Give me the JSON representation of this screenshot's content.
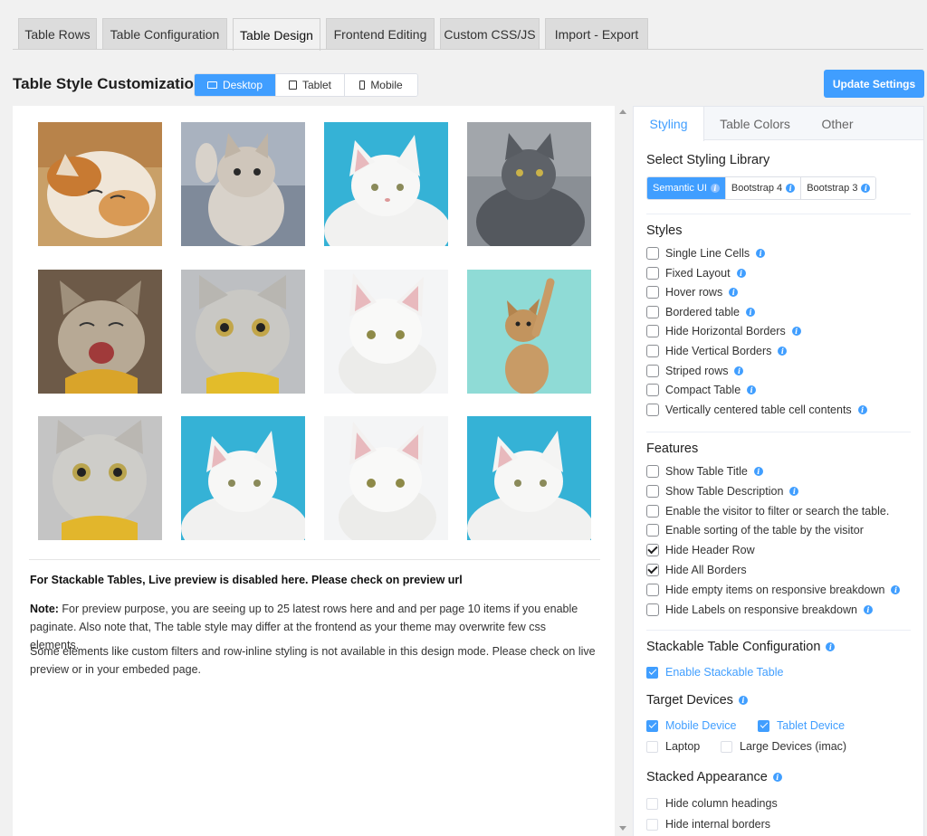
{
  "top_tabs": [
    {
      "label": "Table Rows",
      "active": false
    },
    {
      "label": "Table Configuration",
      "active": false
    },
    {
      "label": "Table Design",
      "active": true
    },
    {
      "label": "Frontend Editing",
      "active": false
    },
    {
      "label": "Custom CSS/JS",
      "active": false
    },
    {
      "label": "Import - Export",
      "active": false
    }
  ],
  "header": {
    "title": "Table Style Customization",
    "devices": [
      {
        "label": "Desktop",
        "icon": "desktop-icon",
        "active": true
      },
      {
        "label": "Tablet",
        "icon": "tablet-icon",
        "active": false
      },
      {
        "label": "Mobile",
        "icon": "mobile-icon",
        "active": false
      }
    ],
    "update_button": "Update Settings"
  },
  "preview": {
    "images": [
      "cat-photo-calico-sleeping",
      "cat-photo-tabby-kitten-waving",
      "cat-photo-white-blue-background",
      "cat-photo-grey-russian-blue",
      "cat-photo-tabby-kitten-yawning",
      "cat-photo-grey-kitten-yellow-scarf",
      "cat-photo-white-kitten",
      "cat-photo-ginger-kitten-reaching",
      "cat-photo-grey-kitten-yellow-scarf-2",
      "cat-photo-white-blue-background-2",
      "cat-photo-white-kitten-2",
      "cat-photo-white-blue-background-3"
    ],
    "stackable_notice": "For Stackable Tables, Live preview is disabled here. Please check on preview url",
    "note_label": "Note:",
    "note_text": " For preview purpose, you are seeing up to 25 latest rows here and and per page 10 items if you enable paginate. Also note that, The table style may differ at the frontend as your theme may overwrite few css elements.",
    "extra_text": "Some elements like custom filters and row-inline styling is not available in this design mode. Please check on live preview or in your embeded page."
  },
  "settings": {
    "tabs": [
      {
        "label": "Styling",
        "active": true
      },
      {
        "label": "Table Colors",
        "active": false
      },
      {
        "label": "Other",
        "active": false
      }
    ],
    "library_title": "Select Styling Library",
    "libraries": [
      {
        "label": "Semantic UI",
        "active": true
      },
      {
        "label": "Bootstrap 4",
        "active": false
      },
      {
        "label": "Bootstrap 3",
        "active": false
      }
    ],
    "styles_title": "Styles",
    "styles": [
      {
        "label": "Single Line Cells",
        "checked": false,
        "info": true
      },
      {
        "label": "Fixed Layout",
        "checked": false,
        "info": true
      },
      {
        "label": "Hover rows",
        "checked": false,
        "info": true
      },
      {
        "label": "Bordered table",
        "checked": false,
        "info": true
      },
      {
        "label": "Hide Horizontal Borders",
        "checked": false,
        "info": true
      },
      {
        "label": "Hide Vertical Borders",
        "checked": false,
        "info": true
      },
      {
        "label": "Striped rows",
        "checked": false,
        "info": true
      },
      {
        "label": "Compact Table",
        "checked": false,
        "info": true
      },
      {
        "label": "Vertically centered table cell contents",
        "checked": false,
        "info": true
      }
    ],
    "features_title": "Features",
    "features": [
      {
        "label": "Show Table Title",
        "checked": false,
        "info": true
      },
      {
        "label": "Show Table Description",
        "checked": false,
        "info": true
      },
      {
        "label": "Enable the visitor to filter or search the table.",
        "checked": false,
        "info": false
      },
      {
        "label": "Enable sorting of the table by the visitor",
        "checked": false,
        "info": false
      },
      {
        "label": "Hide Header Row",
        "checked": true,
        "info": false
      },
      {
        "label": "Hide All Borders",
        "checked": true,
        "info": false
      },
      {
        "label": "Hide empty items on responsive breakdown",
        "checked": false,
        "info": true
      },
      {
        "label": "Hide Labels on responsive breakdown",
        "checked": false,
        "info": true
      }
    ],
    "stackable_title": "Stackable Table Configuration",
    "enable_stackable": {
      "label": "Enable Stackable Table",
      "checked": true
    },
    "target_title": "Target Devices",
    "target_devices": [
      {
        "label": "Mobile Device",
        "checked": true
      },
      {
        "label": "Tablet Device",
        "checked": true
      },
      {
        "label": "Laptop",
        "checked": false
      },
      {
        "label": "Large Devices (imac)",
        "checked": false
      }
    ],
    "stacked_title": "Stacked Appearance",
    "stacked": [
      {
        "label": "Hide column headings",
        "checked": false
      },
      {
        "label": "Hide internal borders",
        "checked": false
      }
    ]
  },
  "colors": {
    "accent": "#409eff",
    "page_bg": "#f1f1f1"
  }
}
